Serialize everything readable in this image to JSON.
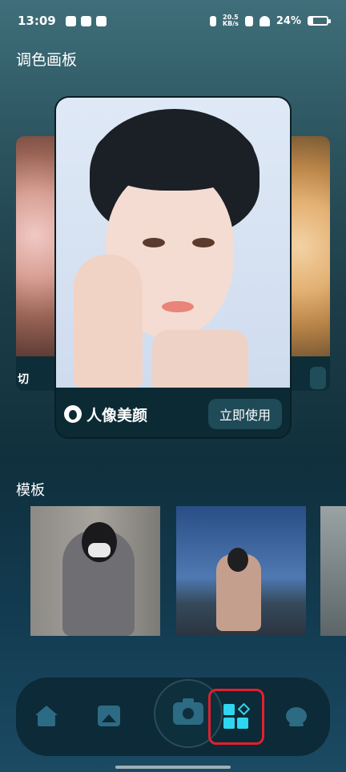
{
  "status_bar": {
    "time": "13:09",
    "net_speed_value": "20.5",
    "net_speed_unit": "KB/s",
    "battery": "24%",
    "battery_level": 0.24
  },
  "palette": {
    "title": "调色画板",
    "left_card_label": "切",
    "main_card": {
      "title": "人像美颜",
      "button": "立即使用"
    }
  },
  "templates": {
    "title": "模板"
  },
  "nav": {
    "items": [
      "home-icon",
      "gallery-icon",
      "camera-icon",
      "templates-icon",
      "profile-icon"
    ],
    "active": "templates",
    "highlight_color": "#e0202e",
    "active_color": "#2ed6f0"
  }
}
